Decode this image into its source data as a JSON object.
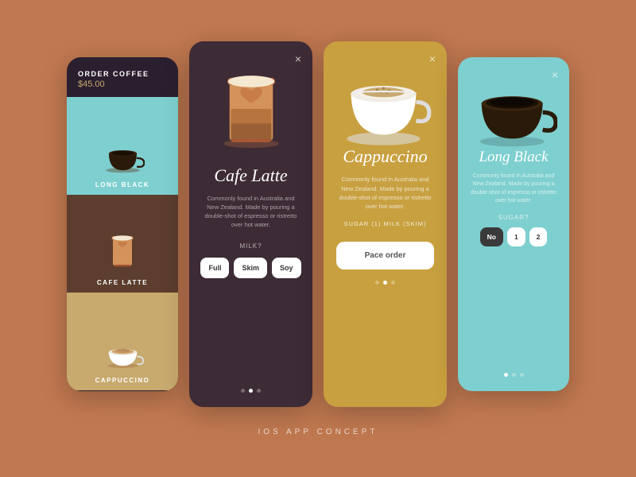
{
  "app": {
    "background": "#C07850",
    "footer_label": "IOS APP CONCEPT"
  },
  "card_menu": {
    "title": "ORDER COFFEE",
    "price": "$45.00",
    "items": [
      {
        "name": "LONG BLACK",
        "bg": "#7ecfcf"
      },
      {
        "name": "CAFE LATTE",
        "bg": "#5c3d2e"
      },
      {
        "name": "CAPPUCCINO",
        "bg": "#c8a96e"
      }
    ]
  },
  "card_latte": {
    "name": "Cafe Latte",
    "description": "Commonly found in Australia and New Zealand. Made by pouring a double-shot of espresso or ristretto over hot water.",
    "option_label": "MILK?",
    "options": [
      "Full",
      "Skim",
      "Soy"
    ],
    "close_icon": "×",
    "dot_count": 3,
    "active_dot": 1
  },
  "card_cappuccino": {
    "name": "Cappuccino",
    "description": "Commonly found in Australia and New Zealand. Made by pouring a double-shot of espresso or ristretto over hot water.",
    "selected_options": "SUGAR (1)  MILK (SKIM)",
    "button_label": "Pace order",
    "close_icon": "×",
    "dot_count": 3,
    "active_dot": 1
  },
  "card_longblack": {
    "name": "Long Black",
    "description": "Commonly found in Australia and New Zealand. Made by pouring a double-shot of espresso or ristretto over hot water.",
    "option_label": "SUGAR?",
    "options": [
      "No",
      "1",
      "2"
    ],
    "close_icon": "×",
    "dot_count": 3,
    "active_dot": 0
  }
}
